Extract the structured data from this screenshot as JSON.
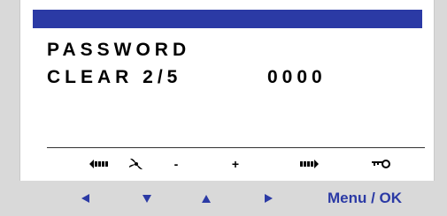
{
  "screen": {
    "line1": "PASSWORD",
    "line2_label": "CLEAR 2/5",
    "line2_value": "0000"
  },
  "softkeys": [
    {
      "icon": "scroll-left-icon"
    },
    {
      "icon": "fan-icon"
    },
    {
      "label": "-"
    },
    {
      "label": "+"
    },
    {
      "icon": "scroll-right-icon"
    },
    {
      "icon": "key-icon"
    }
  ],
  "nav": {
    "left_icon": "arrow-left-icon",
    "down_icon": "arrow-down-icon",
    "up_icon": "arrow-up-icon",
    "right_icon": "arrow-right-icon",
    "menu_ok_label": "Menu / OK"
  },
  "colors": {
    "accent": "#2b3aa5",
    "screen_bg": "#ffffff",
    "frame_bg": "#d9d9d9"
  }
}
